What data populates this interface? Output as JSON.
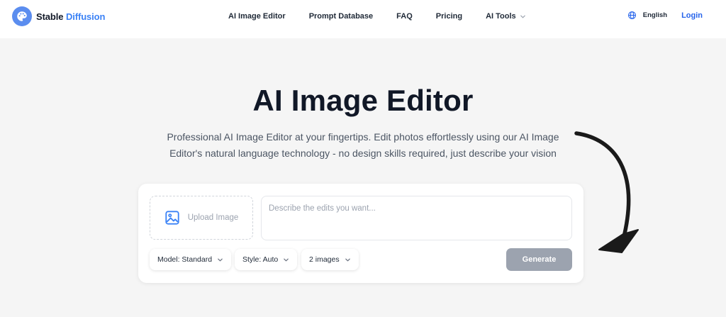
{
  "brand": {
    "name_part1": "Stable",
    "name_part2": "Diffusion"
  },
  "nav": {
    "links": [
      {
        "label": "AI Image Editor"
      },
      {
        "label": "Prompt Database"
      },
      {
        "label": "FAQ"
      },
      {
        "label": "Pricing"
      },
      {
        "label": "AI Tools",
        "icon": "chevron-down-icon"
      }
    ],
    "language": "English",
    "login": "Login"
  },
  "hero": {
    "title": "AI Image Editor",
    "subtitle_line1": "Professional AI Image Editor at your fingertips. Edit photos effortlessly using our AI Image",
    "subtitle_line2": "Editor's natural language technology - no design skills required, just describe your vision"
  },
  "editor": {
    "upload_label": "Upload Image",
    "prompt_placeholder": "Describe the edits you want...",
    "prompt_value": "",
    "model": "Model: Standard",
    "style": "Style: Auto",
    "count": "2 images",
    "generate_label": "Generate"
  },
  "colors": {
    "accent": "#3b82f6",
    "login": "#2563eb",
    "generate_disabled": "#9ca3af",
    "background": "#f5f5f5"
  }
}
